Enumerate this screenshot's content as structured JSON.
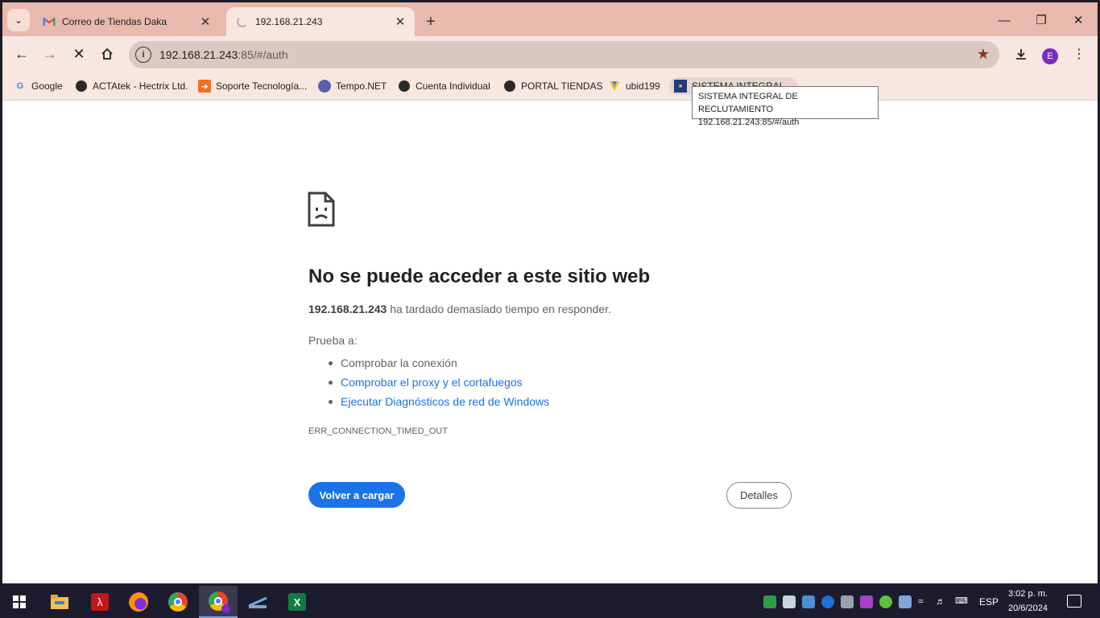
{
  "tabs": [
    {
      "title": "Correo de Tiendas Daka",
      "icon": "gmail-icon"
    },
    {
      "title": "192.168.21.243",
      "icon": "loading-spinner"
    }
  ],
  "toolbar": {
    "url_host": "192.168.21.243",
    "url_path": ":85/#/auth",
    "avatar_letter": "E"
  },
  "bookmarks": [
    {
      "label": "Google",
      "icon": "google-icon"
    },
    {
      "label": "ACTAtek - Hectrix Ltd.",
      "icon": "globe-icon"
    },
    {
      "label": "Soporte Tecnología...",
      "icon": "support-icon"
    },
    {
      "label": "Tempo.NET",
      "icon": "tempo-icon"
    },
    {
      "label": "Cuenta Individual",
      "icon": "globe-icon"
    },
    {
      "label": "PORTAL TIENDAS",
      "icon": "globe-icon"
    },
    {
      "label": "ubid199",
      "icon": "ubid-icon"
    },
    {
      "label": "SISTEMA INTEGRAL...",
      "icon": "sistema-icon"
    }
  ],
  "tooltip": {
    "line1": "SISTEMA INTEGRAL DE RECLUTAMIENTO",
    "line2": "192.168.21.243:85/#/auth"
  },
  "error": {
    "title": "No se puede acceder a este sitio web",
    "host": "192.168.21.243",
    "desc": " ha tardado demasiado tiempo en responder.",
    "try_label": "Prueba a:",
    "suggestions": [
      "Comprobar la conexión",
      "Comprobar el proxy y el cortafuegos",
      "Ejecutar Diagnósticos de red de Windows"
    ],
    "code": "ERR_CONNECTION_TIMED_OUT",
    "reload_label": "Volver a cargar",
    "details_label": "Detalles"
  },
  "taskbar": {
    "language": "ESP",
    "time": "3:02 p. m.",
    "date": "20/6/2024"
  },
  "colors": {
    "chrome_frame": "#e8b9ac",
    "toolbar_bg": "#f8e6e0",
    "link": "#1a73e8",
    "primary_button": "#1a73e8"
  }
}
